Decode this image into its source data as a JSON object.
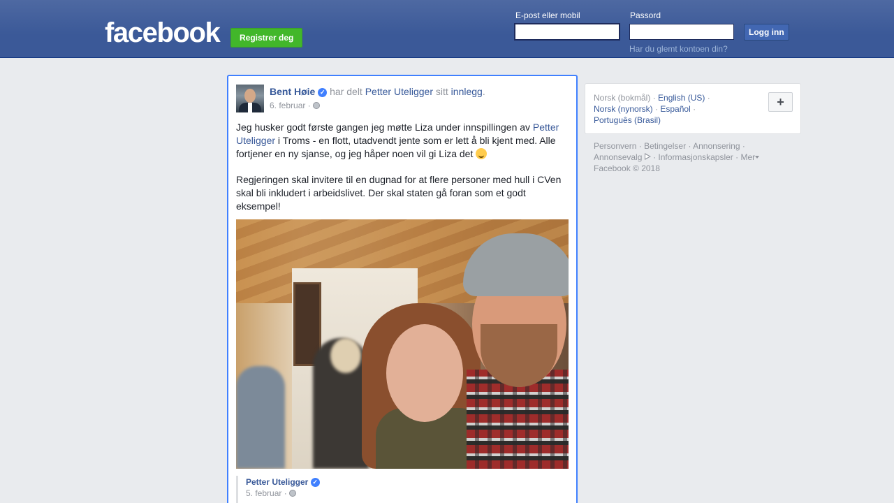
{
  "header": {
    "logo": "facebook",
    "register_label": "Registrer deg",
    "email_label": "E-post eller mobil",
    "password_label": "Passord",
    "email_value": "",
    "password_value": "",
    "login_label": "Logg inn",
    "forgot_label": "Har du glemt kontoen din?"
  },
  "post": {
    "author": "Bent Høie",
    "shared_text": "har delt",
    "shared_from": "Petter Uteligger",
    "possessive": "sitt",
    "post_word": "innlegg",
    "period": ".",
    "date": "6. februar",
    "date_sep": "·",
    "body": {
      "p1_start": "Jeg husker godt første gangen jeg møtte Liza under innspillingen av",
      "p1_link": "Petter Uteligger",
      "p1_end": "i Troms - en flott, utadvendt jente som er lett å bli kjent med. Alle fortjener en ny sjanse, og jeg håper noen vil gi Liza det",
      "p2": "Regjeringen skal invitere til en dugnad for at flere personer med hull i CVen skal bli inkludert i arbeidslivet. Der skal staten gå foran som et godt eksempel!"
    },
    "original": {
      "author": "Petter Uteligger",
      "date": "5. februar",
      "date_sep": "·"
    }
  },
  "sidebar": {
    "languages": {
      "current": "Norsk (bokmål)",
      "options": [
        "English (US)",
        "Norsk (nynorsk)",
        "Español",
        "Português (Brasil)"
      ],
      "sep": "·",
      "add_label": "+"
    },
    "footer": {
      "links": [
        "Personvern",
        "Betingelser",
        "Annonsering",
        "Annonsevalg",
        "Informasjonskapsler",
        "Mer"
      ],
      "sep": "·",
      "copyright": "Facebook © 2018"
    }
  },
  "icons": {
    "verified": "verified-check-icon",
    "globe": "globe-icon",
    "emoji": "smiling-face-icon",
    "adchoices": "adchoices-icon",
    "caret": "caret-down-icon"
  },
  "colors": {
    "brand_blue": "#3b5998",
    "register_green": "#42b72a",
    "focus_border": "#4080ff",
    "link": "#365899"
  }
}
